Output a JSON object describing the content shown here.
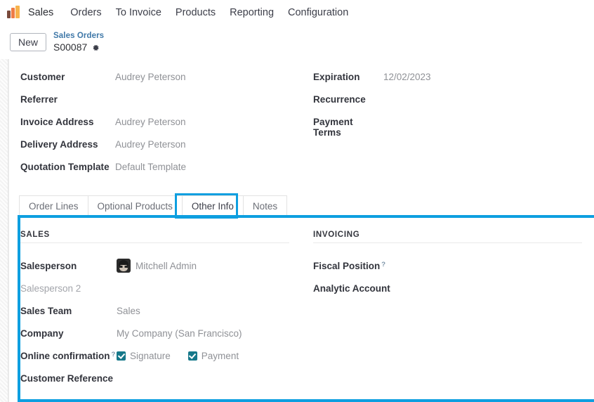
{
  "app": {
    "brand_icon": "sales-bar-chart-icon",
    "name": "Sales"
  },
  "menubar": {
    "items": [
      {
        "label": "Sales"
      },
      {
        "label": "Orders"
      },
      {
        "label": "To Invoice"
      },
      {
        "label": "Products"
      },
      {
        "label": "Reporting"
      },
      {
        "label": "Configuration"
      }
    ]
  },
  "control_panel": {
    "new_button": "New",
    "breadcrumb_parent": "Sales Orders",
    "breadcrumb_current": "S00087",
    "gear_icon": "gear-icon"
  },
  "form": {
    "left": [
      {
        "label": "Customer",
        "value": "Audrey Peterson"
      },
      {
        "label": "Referrer",
        "value": ""
      },
      {
        "label": "Invoice Address",
        "value": "Audrey Peterson"
      },
      {
        "label": "Delivery Address",
        "value": "Audrey Peterson"
      },
      {
        "label": "Quotation Template",
        "value": "Default Template"
      }
    ],
    "right": [
      {
        "label": "Expiration",
        "value": "12/02/2023"
      },
      {
        "label": "Recurrence",
        "value": ""
      },
      {
        "label": "Payment Terms",
        "value": ""
      }
    ]
  },
  "notebook": {
    "tabs": [
      {
        "label": "Order Lines",
        "active": false
      },
      {
        "label": "Optional Products",
        "active": false
      },
      {
        "label": "Other Info",
        "active": true
      },
      {
        "label": "Notes",
        "active": false
      }
    ],
    "highlighted_tab": "Other Info"
  },
  "other_info": {
    "sales": {
      "section_title": "SALES",
      "salesperson_label": "Salesperson",
      "salesperson_value": "Mitchell Admin",
      "salesperson_avatar": "user-avatar",
      "salesperson2_label": "Salesperson 2",
      "salesperson2_value": "",
      "sales_team_label": "Sales Team",
      "sales_team_value": "Sales",
      "company_label": "Company",
      "company_value": "My Company (San Francisco)",
      "online_confirmation_label": "Online confirmation",
      "online_confirmation_help": "?",
      "signature_label": "Signature",
      "signature_checked": true,
      "payment_label": "Payment",
      "payment_checked": true,
      "customer_reference_label": "Customer Reference",
      "customer_reference_value": ""
    },
    "invoicing": {
      "section_title": "INVOICING",
      "fiscal_position_label": "Fiscal Position",
      "fiscal_position_help": "?",
      "fiscal_position_value": "",
      "analytic_account_label": "Analytic Account",
      "analytic_account_value": ""
    }
  },
  "colors": {
    "highlight": "#0d9fe0",
    "checkbox": "#16788a",
    "link": "#3f78a8",
    "brand_orange": "#ef7c45"
  }
}
